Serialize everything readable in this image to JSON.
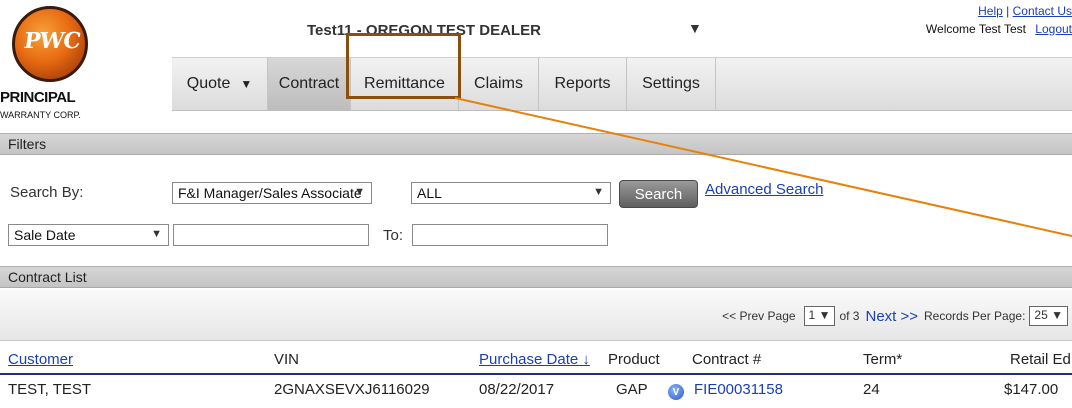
{
  "brand": {
    "logo_mark": "PWC",
    "name_line1": "PRINCIPAL",
    "name_line2": "WARRANTY CORP."
  },
  "header": {
    "dealer": "Test11 - OREGON TEST DEALER",
    "dealer_dropdown_icon": "▼",
    "help": "Help",
    "separator": "|",
    "contact": "Contact Us",
    "welcome": "Welcome Test Test",
    "logout": "Logout"
  },
  "nav": {
    "items": [
      {
        "label": "Quote",
        "caret": "▼"
      },
      {
        "label": "Contract"
      },
      {
        "label": "Remittance"
      },
      {
        "label": "Claims"
      },
      {
        "label": "Reports"
      },
      {
        "label": "Settings"
      }
    ]
  },
  "filters": {
    "title": "Filters",
    "search_by_label": "Search By:",
    "search_by_value": "F&I Manager/Sales Associate",
    "scope_value": "ALL",
    "date_type_value": "Sale Date",
    "from_value": "",
    "to_label": "To:",
    "to_value": "",
    "search_button": "Search",
    "advanced_search": "Advanced Search",
    "dropdown_icon": "▼"
  },
  "contracts": {
    "title": "Contract List",
    "pager": {
      "prev": "<< Prev Page",
      "page": "1",
      "of": "of 3",
      "next": "Next >>",
      "records_label": "Records Per Page:",
      "records": "25",
      "dropdown_icon": "▼"
    },
    "columns": {
      "customer": "Customer",
      "vin": "VIN",
      "purchase_date": "Purchase Date ↓",
      "product": "Product",
      "contract": "Contract #",
      "term": "Term*",
      "retail": "Retail Ed"
    },
    "rows": [
      {
        "customer": "TEST, TEST",
        "vin": "2GNAXSEVXJ6116029",
        "purchase_date": "08/22/2017",
        "product": "GAP",
        "badge": "V",
        "contract": "FIE00031158",
        "term": "24",
        "retail": "$147.00"
      }
    ]
  },
  "colors": {
    "link": "#1a3fb3",
    "highlight_box": "#8a4f0f",
    "annotation_line": "#e8800a",
    "logo": "#e86b12"
  }
}
